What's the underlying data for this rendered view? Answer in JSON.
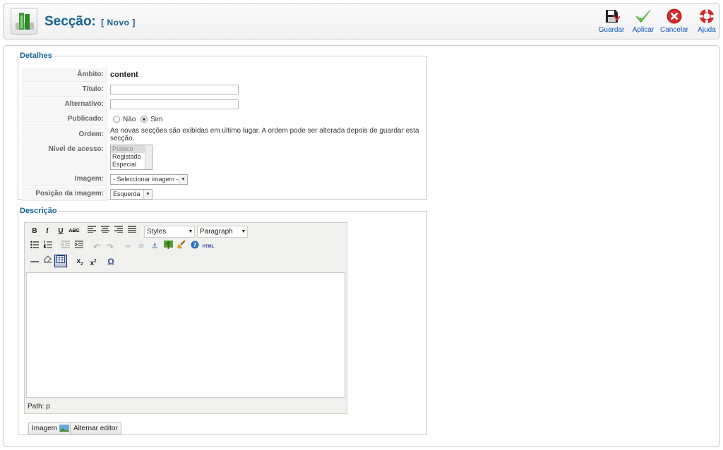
{
  "header": {
    "title": "Secção:",
    "subtitle": "[ Novo ]",
    "toolbar": [
      {
        "label": "Guardar",
        "icon": "save-icon"
      },
      {
        "label": "Aplicar",
        "icon": "apply-check-icon"
      },
      {
        "label": "Cancelar",
        "icon": "cancel-icon"
      },
      {
        "label": "Ajuda",
        "icon": "help-lifebuoy-icon"
      }
    ]
  },
  "details": {
    "legend": "Detalhes",
    "scope_label": "Âmbito:",
    "scope_value": "content",
    "title_label": "Título:",
    "title_value": "",
    "alias_label": "Alternativo:",
    "alias_value": "",
    "published_label": "Publicado:",
    "published_no": "Não",
    "published_yes": "Sim",
    "published_selected": "Sim",
    "order_label": "Ordem:",
    "order_text": "As novas secções são exibidas em último lugar. A ordem pode ser alterada depois de guardar esta secção.",
    "access_label": "Nível de acesso:",
    "access_options": [
      "Público",
      "Registado",
      "Especial"
    ],
    "access_selected": "Público",
    "image_label": "Imagem:",
    "image_value": "- Seleccionar imagem -",
    "image_pos_label": "Posição da imagem:",
    "image_pos_value": "Esquerda"
  },
  "description": {
    "legend": "Descrição",
    "styles_value": "Styles",
    "format_value": "Paragraph",
    "path": "Path: p",
    "image_button": "Imagem",
    "toggle_button": "Alternar editor"
  },
  "colors": {
    "accent": "#146295",
    "link": "#0b55c4"
  }
}
